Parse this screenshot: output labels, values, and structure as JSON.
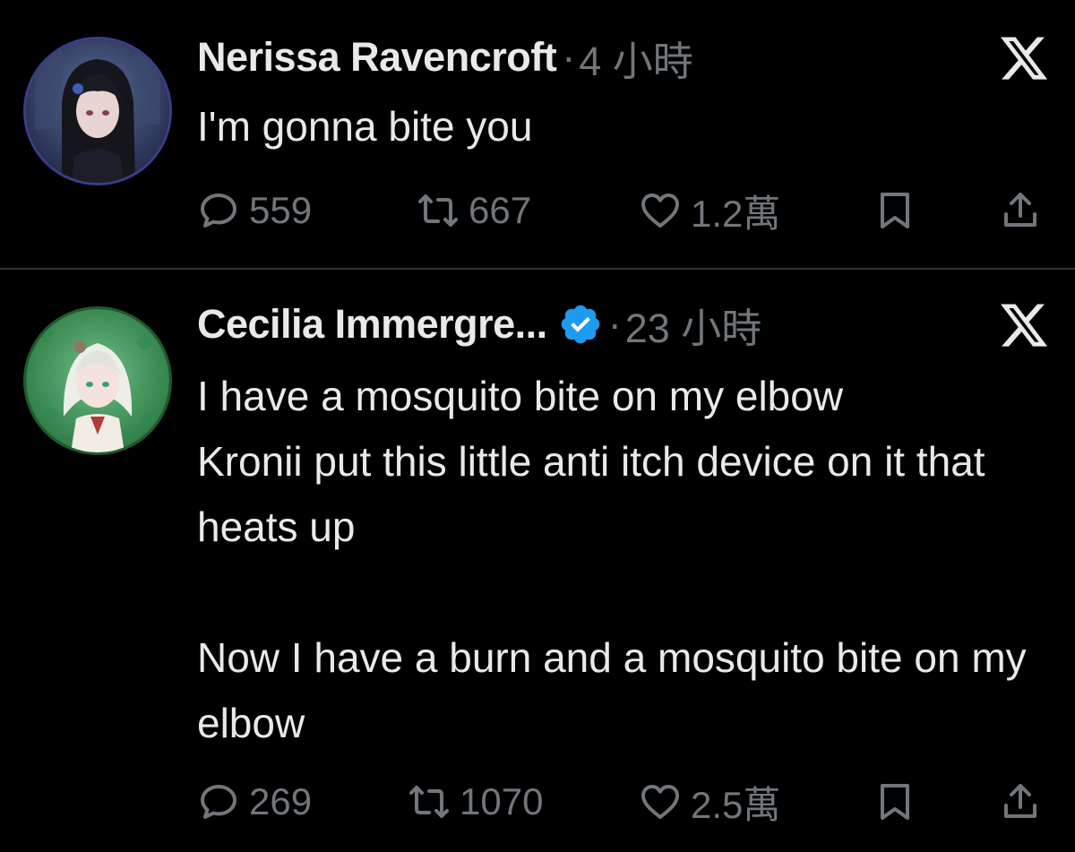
{
  "tweets": [
    {
      "display_name": "Nerissa Ravencroft",
      "verified": false,
      "separator": "·",
      "time": "4 小時",
      "text": "I'm gonna bite you",
      "avatar_icon": "avatar-dark-haired-character",
      "platform_icon": "x-logo-icon",
      "actions": {
        "replies": "559",
        "retweets": "667",
        "likes": "1.2萬"
      }
    },
    {
      "display_name": "Cecilia Immergre...",
      "verified": true,
      "separator": "·",
      "time": "23 小時",
      "text": "I have a mosquito bite on my elbow\nKronii put this little anti itch device on it that heats up\n\nNow I have a burn and a mosquito bite on my elbow",
      "avatar_icon": "avatar-white-haired-character",
      "platform_icon": "x-logo-icon",
      "actions": {
        "replies": "269",
        "retweets": "1070",
        "likes": "2.5萬"
      }
    }
  ],
  "colors": {
    "background": "#000000",
    "text_primary": "#e7e9ea",
    "text_secondary": "#71767b",
    "divider": "#2f3336",
    "verified_badge": "#1d9bf0"
  }
}
